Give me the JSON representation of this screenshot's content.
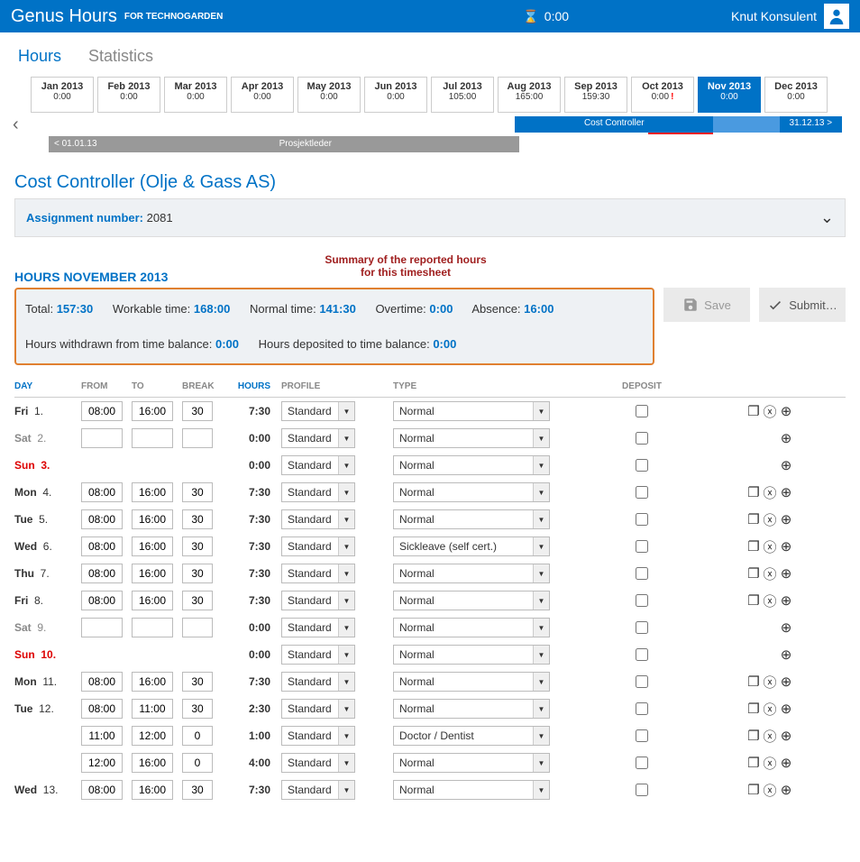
{
  "header": {
    "app": "Genus Hours",
    "sub": "FOR TECHNOGARDEN",
    "timer": "0:00",
    "user": "Knut Konsulent"
  },
  "tabs": {
    "hours": "Hours",
    "stats": "Statistics"
  },
  "months": [
    {
      "label": "Jan 2013",
      "value": "0:00"
    },
    {
      "label": "Feb 2013",
      "value": "0:00"
    },
    {
      "label": "Mar 2013",
      "value": "0:00"
    },
    {
      "label": "Apr 2013",
      "value": "0:00"
    },
    {
      "label": "May 2013",
      "value": "0:00"
    },
    {
      "label": "Jun 2013",
      "value": "0:00"
    },
    {
      "label": "Jul 2013",
      "value": "105:00"
    },
    {
      "label": "Aug 2013",
      "value": "165:00"
    },
    {
      "label": "Sep 2013",
      "value": "159:30"
    },
    {
      "label": "Oct 2013",
      "value": "0:00",
      "warn": true
    },
    {
      "label": "Nov 2013",
      "value": "0:00",
      "selected": true
    },
    {
      "label": "Dec 2013",
      "value": "0:00"
    }
  ],
  "timeline": {
    "bar1": "Cost Controller",
    "bar3": "31.12.13 >",
    "prev": "< 01.01.13",
    "role": "Prosjektleder"
  },
  "assignment": {
    "title": "Cost Controller (Olje & Gass AS)",
    "numLabel": "Assignment number:",
    "num": "2081"
  },
  "annot": {
    "l1": "Summary of the reported hours",
    "l2": "for this timesheet"
  },
  "hoursTitle": "HOURS NOVEMBER 2013",
  "summary": {
    "total_l": "Total:",
    "total_v": "157:30",
    "work_l": "Workable time:",
    "work_v": "168:00",
    "norm_l": "Normal time:",
    "norm_v": "141:30",
    "ot_l": "Overtime:",
    "ot_v": "0:00",
    "abs_l": "Absence:",
    "abs_v": "16:00",
    "wd_l": "Hours withdrawn from time balance:",
    "wd_v": "0:00",
    "dp_l": "Hours deposited to time balance:",
    "dp_v": "0:00"
  },
  "buttons": {
    "save": "Save",
    "submit": "Submit…"
  },
  "cols": {
    "day": "DAY",
    "from": "FROM",
    "to": "TO",
    "break": "BREAK",
    "hours": "HOURS",
    "profile": "PROFILE",
    "type": "TYPE",
    "deposit": "DEPOSIT"
  },
  "rows": [
    {
      "day": "Fri",
      "n": "1.",
      "from": "08:00",
      "to": "16:00",
      "br": "30",
      "h": "7:30",
      "p": "Standard",
      "t": "Normal",
      "copy": true,
      "del": true
    },
    {
      "day": "Sat",
      "n": "2.",
      "from": "",
      "to": "",
      "br": "",
      "h": "0:00",
      "p": "Standard",
      "t": "Normal",
      "cls": "sat"
    },
    {
      "day": "Sun",
      "n": "3.",
      "from": "",
      "to": "",
      "br": "",
      "h": "0:00",
      "p": "Standard",
      "t": "Normal",
      "noin": true,
      "cls": "sun"
    },
    {
      "day": "Mon",
      "n": "4.",
      "from": "08:00",
      "to": "16:00",
      "br": "30",
      "h": "7:30",
      "p": "Standard",
      "t": "Normal",
      "copy": true,
      "del": true
    },
    {
      "day": "Tue",
      "n": "5.",
      "from": "08:00",
      "to": "16:00",
      "br": "30",
      "h": "7:30",
      "p": "Standard",
      "t": "Normal",
      "copy": true,
      "del": true
    },
    {
      "day": "Wed",
      "n": "6.",
      "from": "08:00",
      "to": "16:00",
      "br": "30",
      "h": "7:30",
      "p": "Standard",
      "t": "Sickleave (self cert.)",
      "copy": true,
      "del": true
    },
    {
      "day": "Thu",
      "n": "7.",
      "from": "08:00",
      "to": "16:00",
      "br": "30",
      "h": "7:30",
      "p": "Standard",
      "t": "Normal",
      "copy": true,
      "del": true
    },
    {
      "day": "Fri",
      "n": "8.",
      "from": "08:00",
      "to": "16:00",
      "br": "30",
      "h": "7:30",
      "p": "Standard",
      "t": "Normal",
      "copy": true,
      "del": true
    },
    {
      "day": "Sat",
      "n": "9.",
      "from": "",
      "to": "",
      "br": "",
      "h": "0:00",
      "p": "Standard",
      "t": "Normal",
      "cls": "sat"
    },
    {
      "day": "Sun",
      "n": "10.",
      "from": "",
      "to": "",
      "br": "",
      "h": "0:00",
      "p": "Standard",
      "t": "Normal",
      "noin": true,
      "cls": "sun"
    },
    {
      "day": "Mon",
      "n": "11.",
      "from": "08:00",
      "to": "16:00",
      "br": "30",
      "h": "7:30",
      "p": "Standard",
      "t": "Normal",
      "copy": true,
      "del": true
    },
    {
      "day": "Tue",
      "n": "12.",
      "from": "08:00",
      "to": "11:00",
      "br": "30",
      "h": "2:30",
      "p": "Standard",
      "t": "Normal",
      "copy": true,
      "del": true
    },
    {
      "day": "",
      "n": "",
      "from": "11:00",
      "to": "12:00",
      "br": "0",
      "h": "1:00",
      "p": "Standard",
      "t": "Doctor / Dentist",
      "copy": true,
      "del": true
    },
    {
      "day": "",
      "n": "",
      "from": "12:00",
      "to": "16:00",
      "br": "0",
      "h": "4:00",
      "p": "Standard",
      "t": "Normal",
      "copy": true,
      "del": true
    },
    {
      "day": "Wed",
      "n": "13.",
      "from": "08:00",
      "to": "16:00",
      "br": "30",
      "h": "7:30",
      "p": "Standard",
      "t": "Normal",
      "copy": true,
      "del": true
    }
  ]
}
